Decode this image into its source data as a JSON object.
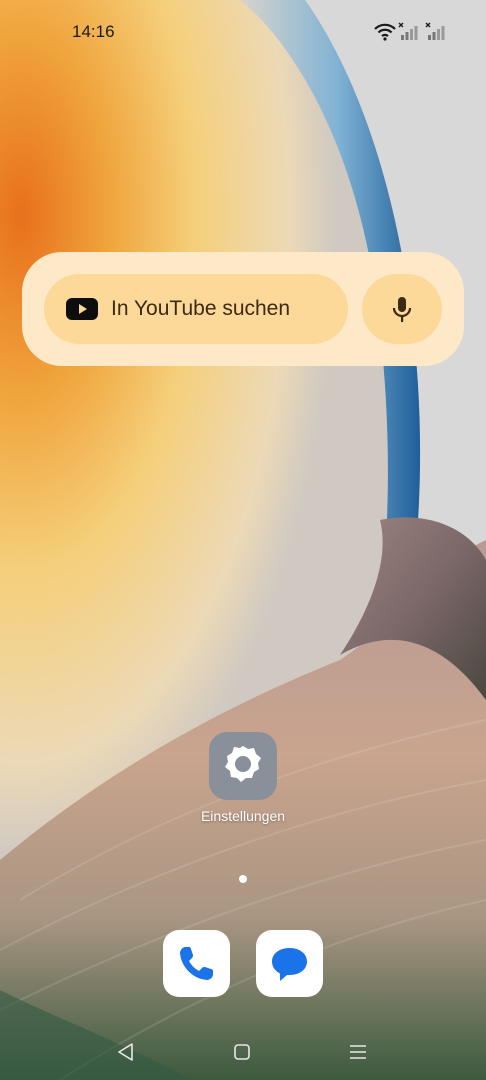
{
  "status_bar": {
    "time": "14:16",
    "icons": [
      "wifi-icon",
      "signal-sim1-no-service-icon",
      "signal-sim2-no-service-icon"
    ]
  },
  "search_widget": {
    "label": "In YouTube suchen",
    "icon": "youtube-icon",
    "mic_icon": "microphone-icon",
    "background": "#fde9c8",
    "pill_color": "#fcd999"
  },
  "home_apps": [
    {
      "label": "Einstellungen",
      "icon": "gear-icon"
    }
  ],
  "page_indicator": {
    "current": 1,
    "total": 1
  },
  "dock": [
    {
      "app": "phone",
      "icon": "phone-icon"
    },
    {
      "app": "messages",
      "icon": "chat-bubble-icon"
    }
  ],
  "navigation_bar": {
    "buttons": [
      "back-icon",
      "home-icon",
      "recents-icon"
    ]
  },
  "colors": {
    "google_blue": "#1a73e8",
    "settings_tile": "#8a909a"
  }
}
